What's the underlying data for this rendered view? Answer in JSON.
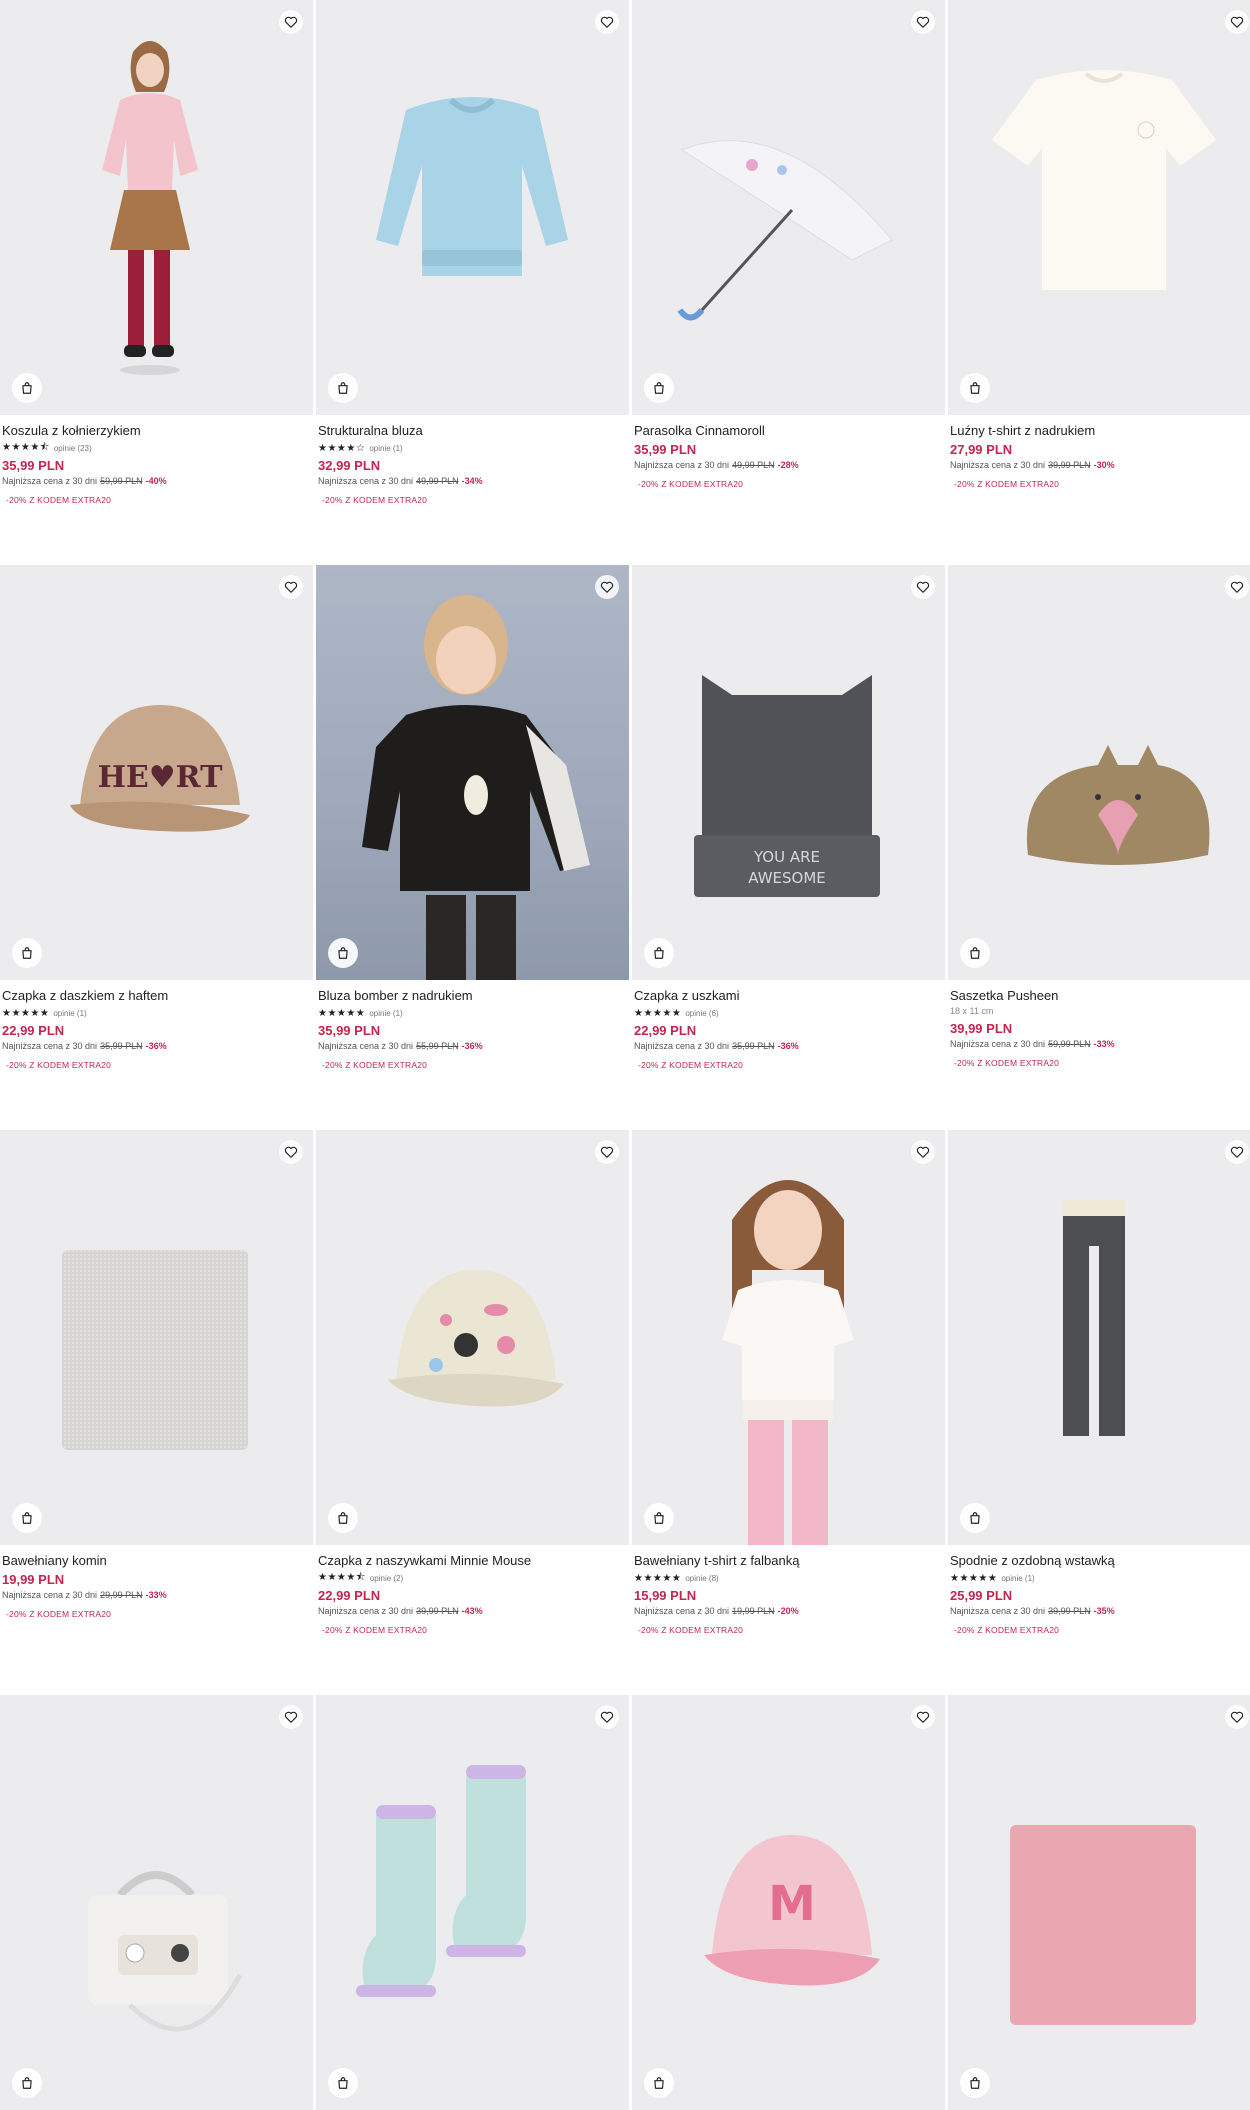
{
  "products": [
    {
      "name": "Koszula z kołnierzykiem",
      "stars": "★★★★⯪",
      "reviews": "opinie (23)",
      "price": "35,99 PLN",
      "lowest_label": "Najniższa cena z 30 dni",
      "old_price": "59,99 PLN",
      "discount": "-40%",
      "promo": "-20% Z KODEM EXTRA20",
      "image": "girl-pink-shirt"
    },
    {
      "name": "Strukturalna bluza",
      "stars": "★★★★☆",
      "reviews": "opinie (1)",
      "price": "32,99 PLN",
      "lowest_label": "Najniższa cena z 30 dni",
      "old_price": "49,99 PLN",
      "discount": "-34%",
      "promo": "-20% Z KODEM EXTRA20",
      "image": "blue-sweatshirt"
    },
    {
      "name": "Parasolka Cinnamoroll",
      "price": "35,99 PLN",
      "lowest_label": "Najniższa cena z 30 dni",
      "old_price": "49,99 PLN",
      "discount": "-28%",
      "promo": "-20% Z KODEM EXTRA20",
      "image": "umbrella"
    },
    {
      "name": "Luźny t-shirt z nadrukiem",
      "price": "27,99 PLN",
      "lowest_label": "Najniższa cena z 30 dni",
      "old_price": "39,99 PLN",
      "discount": "-30%",
      "promo": "-20% Z KODEM EXTRA20",
      "image": "cream-tshirt"
    },
    {
      "name": "Czapka z daszkiem z haftem",
      "stars": "★★★★★",
      "reviews": "opinie (1)",
      "price": "22,99 PLN",
      "lowest_label": "Najniższa cena z 30 dni",
      "old_price": "35,99 PLN",
      "discount": "-36%",
      "promo": "-20% Z KODEM EXTRA20",
      "image": "heart-cap",
      "cap_text": "HE♥RT"
    },
    {
      "name": "Bluza bomber z nadrukiem",
      "stars": "★★★★★",
      "reviews": "opinie (1)",
      "price": "35,99 PLN",
      "lowest_label": "Najniższa cena z 30 dni",
      "old_price": "55,99 PLN",
      "discount": "-36%",
      "promo": "-20% Z KODEM EXTRA20",
      "image": "bomber-kid"
    },
    {
      "name": "Czapka z uszkami",
      "stars": "★★★★★",
      "reviews": "opinie (6)",
      "price": "22,99 PLN",
      "lowest_label": "Najniższa cena z 30 dni",
      "old_price": "35,99 PLN",
      "discount": "-36%",
      "promo": "-20% Z KODEM EXTRA20",
      "image": "beanie-ears",
      "beanie_text": "YOU ARE AWESOME"
    },
    {
      "name": "Saszetka Pusheen",
      "size": "18 x 11 cm",
      "price": "39,99 PLN",
      "lowest_label": "Najniższa cena z 30 dni",
      "old_price": "59,99 PLN",
      "discount": "-33%",
      "promo": "-20% Z KODEM EXTRA20",
      "image": "pusheen-pouch"
    },
    {
      "name": "Bawełniany komin",
      "price": "19,99 PLN",
      "lowest_label": "Najniższa cena z 30 dni",
      "old_price": "29,99 PLN",
      "discount": "-33%",
      "promo": "-20% Z KODEM EXTRA20",
      "image": "grey-snood"
    },
    {
      "name": "Czapka z naszywkami Minnie Mouse",
      "stars": "★★★★⯪",
      "reviews": "opinie (2)",
      "price": "22,99 PLN",
      "lowest_label": "Najniższa cena z 30 dni",
      "old_price": "39,99 PLN",
      "discount": "-43%",
      "promo": "-20% Z KODEM EXTRA20",
      "image": "minnie-cap"
    },
    {
      "name": "Bawełniany t-shirt z falbanką",
      "stars": "★★★★★",
      "reviews": "opinie (8)",
      "price": "15,99 PLN",
      "lowest_label": "Najniższa cena z 30 dni",
      "old_price": "19,99 PLN",
      "discount": "-20%",
      "promo": "-20% Z KODEM EXTRA20",
      "image": "girl-ruffle-tee"
    },
    {
      "name": "Spodnie z ozdobną wstawką",
      "stars": "★★★★★",
      "reviews": "opinie (1)",
      "price": "25,99 PLN",
      "lowest_label": "Najniższa cena z 30 dni",
      "old_price": "39,99 PLN",
      "discount": "-35%",
      "promo": "-20% Z KODEM EXTRA20",
      "image": "grey-leggings"
    },
    {
      "image": "hello-kitty-bag"
    },
    {
      "image": "rain-boots"
    },
    {
      "image": "my-melody-cap"
    },
    {
      "image": "pink-snood"
    }
  ],
  "colors": {
    "price": "#c3264e",
    "tile_bg": "#ececee"
  },
  "icons": {
    "favorite": "heart-outline-icon",
    "cart": "shopping-bag-icon"
  }
}
